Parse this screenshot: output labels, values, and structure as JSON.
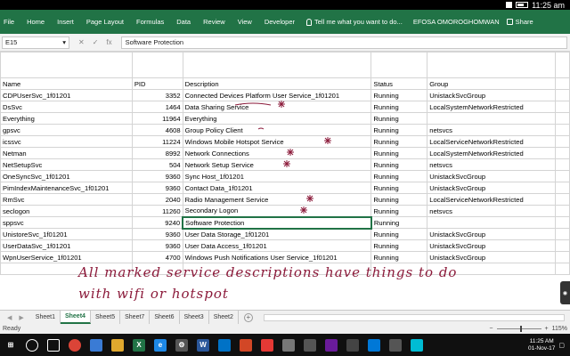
{
  "statusbar": {
    "time": "11:25 am"
  },
  "ribbon": {
    "tabs": [
      "File",
      "Home",
      "Insert",
      "Page Layout",
      "Formulas",
      "Data",
      "Review",
      "View",
      "Developer"
    ],
    "tell_me": "Tell me what you want to do...",
    "user": "EFOSA OMOROGHOMWAN",
    "share": "Share"
  },
  "formula_bar": {
    "cell_ref": "E15",
    "cancel": "✕",
    "enter": "✓",
    "fx": "fx",
    "content": "Software Protection"
  },
  "sheet": {
    "headers": [
      "Name",
      "PID",
      "Description",
      "Status",
      "Group"
    ],
    "rows": [
      [
        "CDPUserSvc_1f01201",
        "3352",
        "Connected Devices Platform User Service_1f01201",
        "Running",
        "UnistackSvcGroup"
      ],
      [
        "DsSvc",
        "1464",
        "Data Sharing Service",
        "Running",
        "LocalSystemNetworkRestricted"
      ],
      [
        "Everything",
        "11964",
        "Everything",
        "Running",
        ""
      ],
      [
        "gpsvc",
        "4608",
        "Group Policy Client",
        "Running",
        "netsvcs"
      ],
      [
        "icssvc",
        "11224",
        "Windows Mobile Hotspot Service",
        "Running",
        "LocalServiceNetworkRestricted"
      ],
      [
        "Netman",
        "8992",
        "Network Connections",
        "Running",
        "LocalSystemNetworkRestricted"
      ],
      [
        "NetSetupSvc",
        "504",
        "Network Setup Service",
        "Running",
        "netsvcs"
      ],
      [
        "OneSyncSvc_1f01201",
        "9360",
        "Sync Host_1f01201",
        "Running",
        "UnistackSvcGroup"
      ],
      [
        "PimIndexMaintenanceSvc_1f01201",
        "9360",
        "Contact Data_1f01201",
        "Running",
        "UnistackSvcGroup"
      ],
      [
        "RmSvc",
        "2040",
        "Radio Management Service",
        "Running",
        "LocalServiceNetworkRestricted"
      ],
      [
        "seclogon",
        "11260",
        "Secondary Logon",
        "Running",
        "netsvcs"
      ],
      [
        "sppsvc",
        "9240",
        "Software Protection",
        "Running",
        ""
      ],
      [
        "UnistoreSvc_1f01201",
        "9360",
        "User Data Storage_1f01201",
        "Running",
        "UnistackSvcGroup"
      ],
      [
        "UserDataSvc_1f01201",
        "9360",
        "User Data Access_1f01201",
        "Running",
        "UnistackSvcGroup"
      ],
      [
        "WpnUserService_1f01201",
        "4700",
        "Windows Push Notifications User Service_1f01201",
        "Running",
        "UnistackSvcGroup"
      ]
    ]
  },
  "annotation": {
    "note": "All marked service descriptions have things to do with wifi or hotspot"
  },
  "sheet_tabs": [
    "Sheet1",
    "Sheet4",
    "Sheet5",
    "Sheet7",
    "Sheet6",
    "Sheet3",
    "Sheet2"
  ],
  "active_tab": "Sheet4",
  "xl_status": {
    "ready": "Ready",
    "zoom": "115%"
  },
  "taskbar": {
    "time": "11:25 AM",
    "date": "01-Nov-17"
  },
  "colors": {
    "excel_green": "#217346",
    "annotation": "#8b1a3a"
  }
}
